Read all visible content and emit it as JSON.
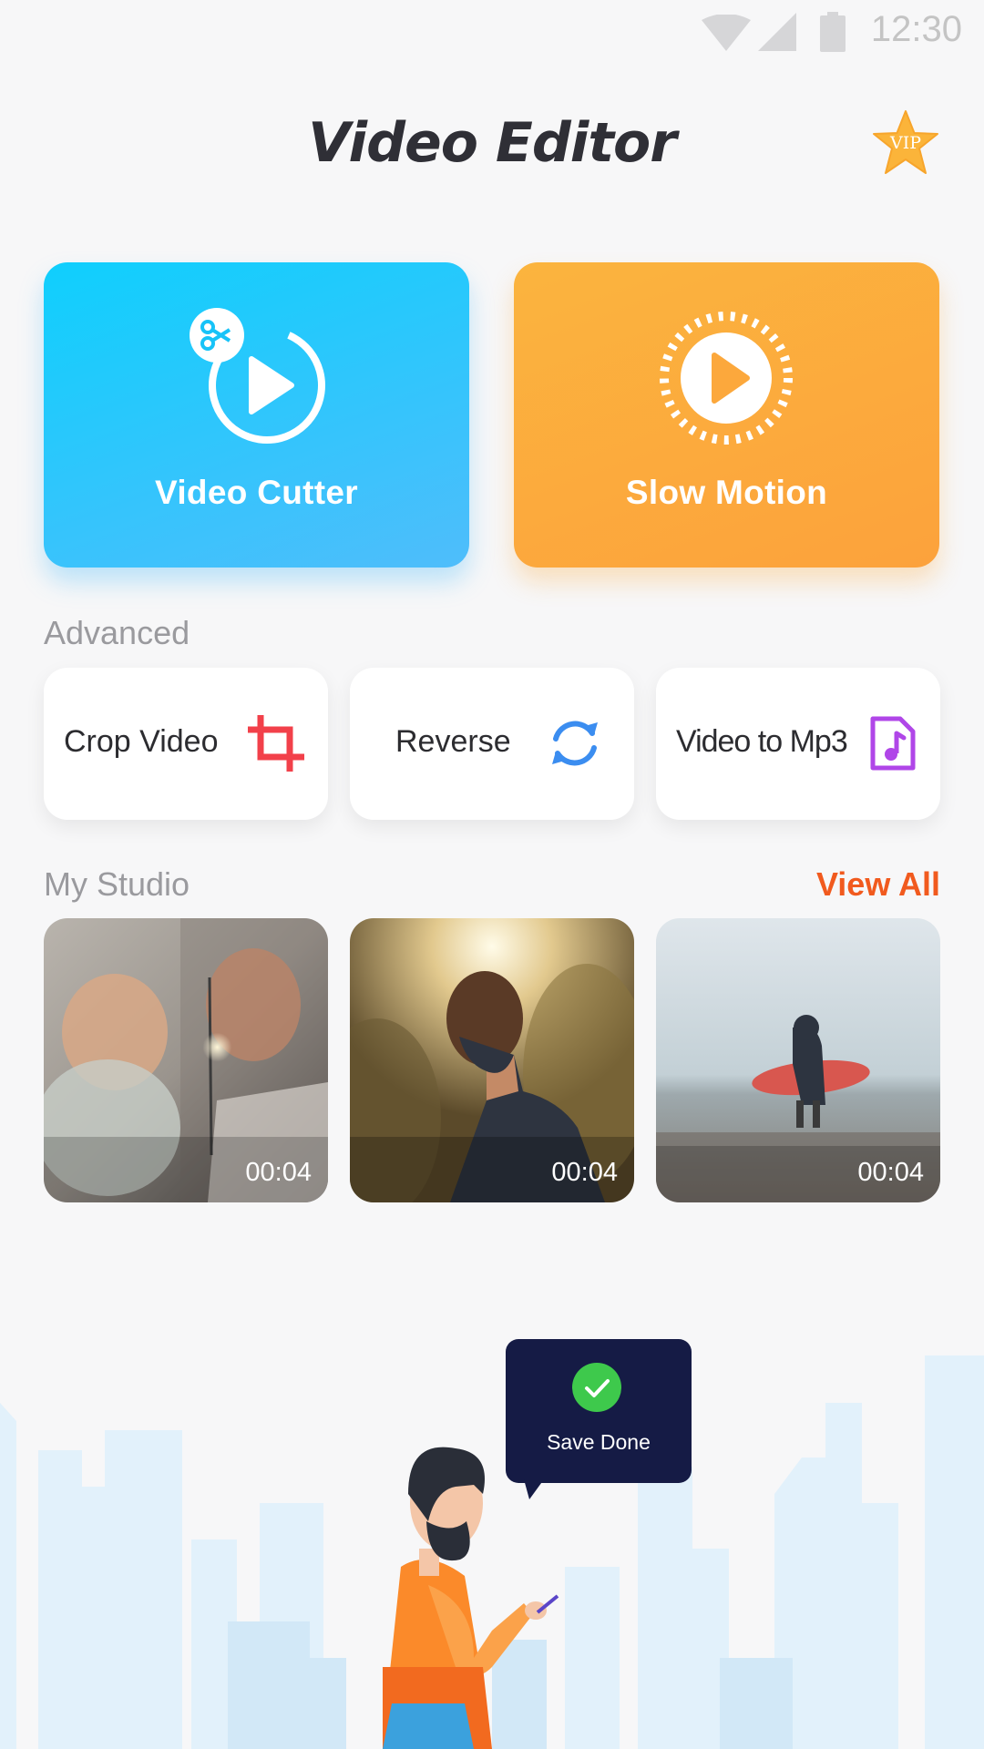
{
  "status_bar": {
    "time": "12:30",
    "icons": [
      "wifi-icon",
      "signal-icon",
      "battery-icon"
    ]
  },
  "header": {
    "title": "Video Editor",
    "vip_label": "VIP"
  },
  "main_tools": [
    {
      "label": "Video Cutter",
      "icon": "video-cutter-icon",
      "color": "#0fcffd"
    },
    {
      "label": "Slow Motion",
      "icon": "slow-motion-icon",
      "color": "#fbb43e"
    }
  ],
  "advanced": {
    "heading": "Advanced",
    "tools": [
      {
        "label": "Crop Video",
        "icon": "crop-icon",
        "color": "#f2404a"
      },
      {
        "label": "Reverse",
        "icon": "reverse-icon",
        "color": "#3b8df0"
      },
      {
        "label": "Video to Mp3",
        "icon": "music-file-icon",
        "color": "#b046e8"
      }
    ]
  },
  "studio": {
    "heading": "My Studio",
    "view_all_label": "View All",
    "view_all_color": "#f15a1e",
    "videos": [
      {
        "duration": "00:04",
        "subject": "child-with-sparkler"
      },
      {
        "duration": "00:04",
        "subject": "man-in-sunlight"
      },
      {
        "duration": "00:04",
        "subject": "surfer-on-beach"
      }
    ]
  },
  "toast": {
    "text": "Save Done",
    "icon": "check-icon",
    "check_color": "#3ec94c"
  }
}
